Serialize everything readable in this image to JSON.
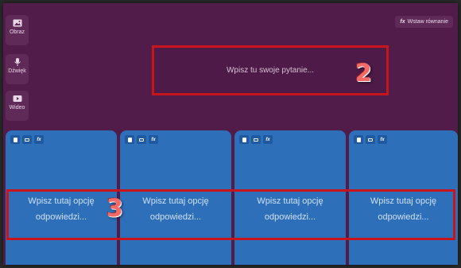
{
  "media_buttons": [
    {
      "icon": "image-icon",
      "label": "Obraz"
    },
    {
      "icon": "microphone-icon",
      "label": "Dźwięk"
    },
    {
      "icon": "video-icon",
      "label": "Wideo"
    }
  ],
  "equation_button": {
    "icon_text": "fx",
    "label": "Wstaw równanie"
  },
  "question": {
    "placeholder": "Wpisz tu swoje pytanie..."
  },
  "annotations": {
    "question_number": "2",
    "answers_number": "3"
  },
  "answers": [
    {
      "line1": "Wpisz tutaj opcję",
      "line2": "odpowiedzi..."
    },
    {
      "line1": "Wpisz tutaj opcję",
      "line2": "odpowiedzi..."
    },
    {
      "line1": "Wpisz tutaj opcję",
      "line2": "odpowiedzi..."
    },
    {
      "line1": "Wpisz tutaj opcję",
      "line2": "odpowiedzi..."
    }
  ],
  "answer_tool_fx": "fx",
  "colors": {
    "background": "#511b4a",
    "card": "#2e6fba",
    "highlight": "#c8151c"
  }
}
